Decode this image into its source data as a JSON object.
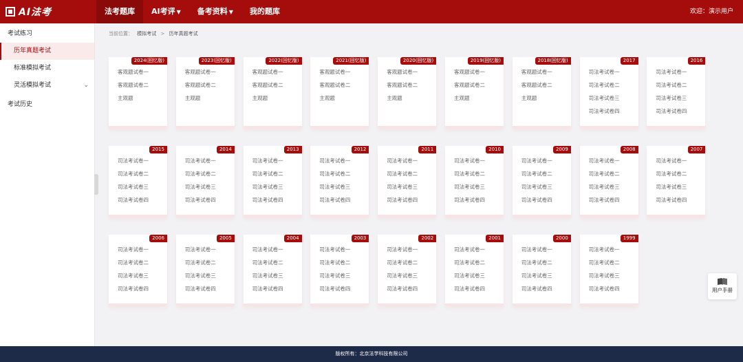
{
  "app": {
    "logo_text": "AI法考"
  },
  "nav": {
    "items": [
      {
        "label": "法考题库",
        "active": true,
        "dropdown": false
      },
      {
        "label": "AI考评",
        "active": false,
        "dropdown": true
      },
      {
        "label": "备考资料",
        "active": false,
        "dropdown": true
      },
      {
        "label": "我的题库",
        "active": false,
        "dropdown": false
      }
    ],
    "user": "欢迎：演示用户"
  },
  "sidebar": {
    "group1": "考试练习",
    "items": [
      {
        "label": "历年真题考试",
        "active": true
      },
      {
        "label": "标准模拟考试",
        "active": false
      },
      {
        "label": "灵活模拟考试",
        "active": false,
        "expandable": true
      }
    ],
    "group2": "考试历史"
  },
  "breadcrumb": {
    "prefix": "当前位置：",
    "level1": "模拟考试",
    "sep": ">",
    "level2": "历年真题考试"
  },
  "cards": [
    {
      "year": "2024(回忆版)",
      "papers": [
        "客观题试卷一",
        "客观题试卷二",
        "主观题"
      ]
    },
    {
      "year": "2023(回忆版)",
      "papers": [
        "客观题试卷一",
        "客观题试卷二",
        "主观题"
      ]
    },
    {
      "year": "2022(回忆版)",
      "papers": [
        "客观题试卷一",
        "客观题试卷二",
        "主观题"
      ]
    },
    {
      "year": "2021(回忆版)",
      "papers": [
        "客观题试卷一",
        "客观题试卷二",
        "主观题"
      ]
    },
    {
      "year": "2020(回忆版)",
      "papers": [
        "客观题试卷一",
        "客观题试卷二",
        "主观题"
      ]
    },
    {
      "year": "2019(回忆版)",
      "papers": [
        "客观题试卷一",
        "客观题试卷二",
        "主观题"
      ]
    },
    {
      "year": "2018(回忆版)",
      "papers": [
        "客观题试卷一",
        "客观题试卷二",
        "主观题"
      ]
    },
    {
      "year": "2017",
      "papers": [
        "司法考试卷一",
        "司法考试卷二",
        "司法考试卷三",
        "司法考试卷四"
      ]
    },
    {
      "year": "2016",
      "papers": [
        "司法考试卷一",
        "司法考试卷二",
        "司法考试卷三",
        "司法考试卷四"
      ]
    },
    {
      "year": "2015",
      "papers": [
        "司法考试卷一",
        "司法考试卷二",
        "司法考试卷三",
        "司法考试卷四"
      ]
    },
    {
      "year": "2014",
      "papers": [
        "司法考试卷一",
        "司法考试卷二",
        "司法考试卷三",
        "司法考试卷四"
      ]
    },
    {
      "year": "2013",
      "papers": [
        "司法考试卷一",
        "司法考试卷二",
        "司法考试卷三",
        "司法考试卷四"
      ]
    },
    {
      "year": "2012",
      "papers": [
        "司法考试卷一",
        "司法考试卷二",
        "司法考试卷三",
        "司法考试卷四"
      ]
    },
    {
      "year": "2011",
      "papers": [
        "司法考试卷一",
        "司法考试卷二",
        "司法考试卷三",
        "司法考试卷四"
      ]
    },
    {
      "year": "2010",
      "papers": [
        "司法考试卷一",
        "司法考试卷二",
        "司法考试卷三",
        "司法考试卷四"
      ]
    },
    {
      "year": "2009",
      "papers": [
        "司法考试卷一",
        "司法考试卷二",
        "司法考试卷三",
        "司法考试卷四"
      ]
    },
    {
      "year": "2008",
      "papers": [
        "司法考试卷一",
        "司法考试卷二",
        "司法考试卷三",
        "司法考试卷四"
      ]
    },
    {
      "year": "2007",
      "papers": [
        "司法考试卷一",
        "司法考试卷二",
        "司法考试卷三",
        "司法考试卷四"
      ]
    },
    {
      "year": "2006",
      "papers": [
        "司法考试卷一",
        "司法考试卷二",
        "司法考试卷三",
        "司法考试卷四"
      ]
    },
    {
      "year": "2005",
      "papers": [
        "司法考试卷一",
        "司法考试卷二",
        "司法考试卷三",
        "司法考试卷四"
      ]
    },
    {
      "year": "2004",
      "papers": [
        "司法考试卷一",
        "司法考试卷二",
        "司法考试卷三",
        "司法考试卷四"
      ]
    },
    {
      "year": "2003",
      "papers": [
        "司法考试卷一",
        "司法考试卷二",
        "司法考试卷三",
        "司法考试卷四"
      ]
    },
    {
      "year": "2002",
      "papers": [
        "司法考试卷一",
        "司法考试卷二",
        "司法考试卷三",
        "司法考试卷四"
      ]
    },
    {
      "year": "2001",
      "papers": [
        "司法考试卷一",
        "司法考试卷二",
        "司法考试卷三",
        "司法考试卷四"
      ]
    },
    {
      "year": "2000",
      "papers": [
        "司法考试卷一",
        "司法考试卷二",
        "司法考试卷三",
        "司法考试卷四"
      ]
    },
    {
      "year": "1999",
      "papers": [
        "司法考试卷一",
        "司法考试卷二",
        "司法考试卷三",
        "司法考试卷四"
      ]
    }
  ],
  "manual": {
    "label": "用户手册",
    "icon": "book-icon"
  },
  "footer": {
    "text": "版权所有：北京法学科技有限公司"
  },
  "colors": {
    "brand": "#a50d0d",
    "footer": "#1d2a48"
  }
}
